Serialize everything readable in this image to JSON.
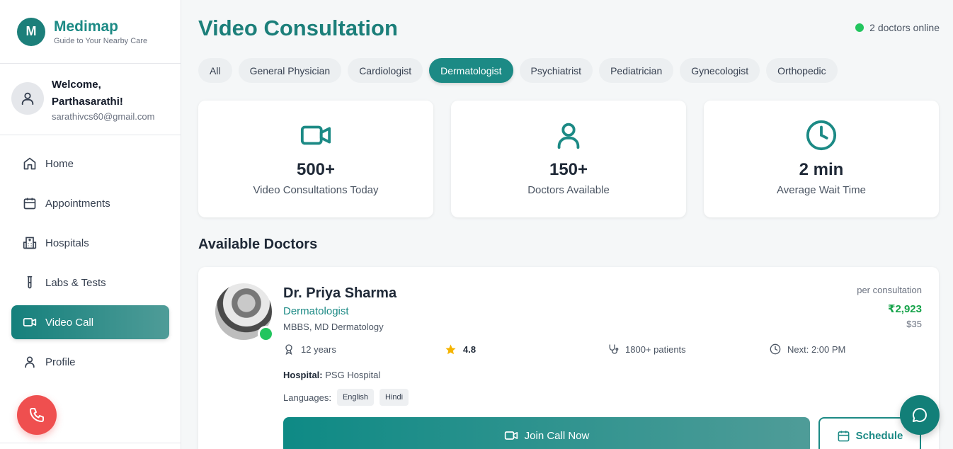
{
  "brand": {
    "logo_letter": "M",
    "name": "Medimap",
    "tagline": "Guide to Your Nearby Care"
  },
  "user": {
    "welcome_line1": "Welcome,",
    "welcome_line2": "Parthasarathi!",
    "email": "sarathivcs60@gmail.com"
  },
  "nav": {
    "items": [
      {
        "label": "Home",
        "icon": "home-icon"
      },
      {
        "label": "Appointments",
        "icon": "calendar-icon"
      },
      {
        "label": "Hospitals",
        "icon": "hospital-icon"
      },
      {
        "label": "Labs & Tests",
        "icon": "test-tube-icon"
      },
      {
        "label": "Video Call",
        "icon": "video-icon",
        "active": true
      },
      {
        "label": "Profile",
        "icon": "user-icon"
      }
    ]
  },
  "page": {
    "title": "Video Consultation",
    "online_status": "2 doctors online"
  },
  "filters": [
    "All",
    "General Physician",
    "Cardiologist",
    "Dermatologist",
    "Psychiatrist",
    "Pediatrician",
    "Gynecologist",
    "Orthopedic"
  ],
  "active_filter": "Dermatologist",
  "stats": [
    {
      "value": "500+",
      "label": "Video Consultations Today",
      "icon": "video-icon"
    },
    {
      "value": "150+",
      "label": "Doctors Available",
      "icon": "user-icon"
    },
    {
      "value": "2 min",
      "label": "Average Wait Time",
      "icon": "clock-icon"
    }
  ],
  "section_title": "Available Doctors",
  "doctor": {
    "name": "Dr. Priya Sharma",
    "specialty": "Dermatologist",
    "qualification": "MBBS, MD Dermatology",
    "price_label": "per consultation",
    "price_inr": "₹2,923",
    "price_usd": "$35",
    "experience": "12 years",
    "rating": "4.8",
    "patients": "1800+ patients",
    "next_slot": "Next: 2:00 PM",
    "hospital_label": "Hospital:",
    "hospital": "PSG Hospital",
    "languages_label": "Languages:",
    "languages": [
      "English",
      "Hindi"
    ],
    "join_label": "Join Call Now",
    "schedule_label": "Schedule"
  },
  "colors": {
    "primary": "#1c8a85",
    "online": "#22c55e",
    "call": "#ef4f4f",
    "price": "#16a34a"
  }
}
